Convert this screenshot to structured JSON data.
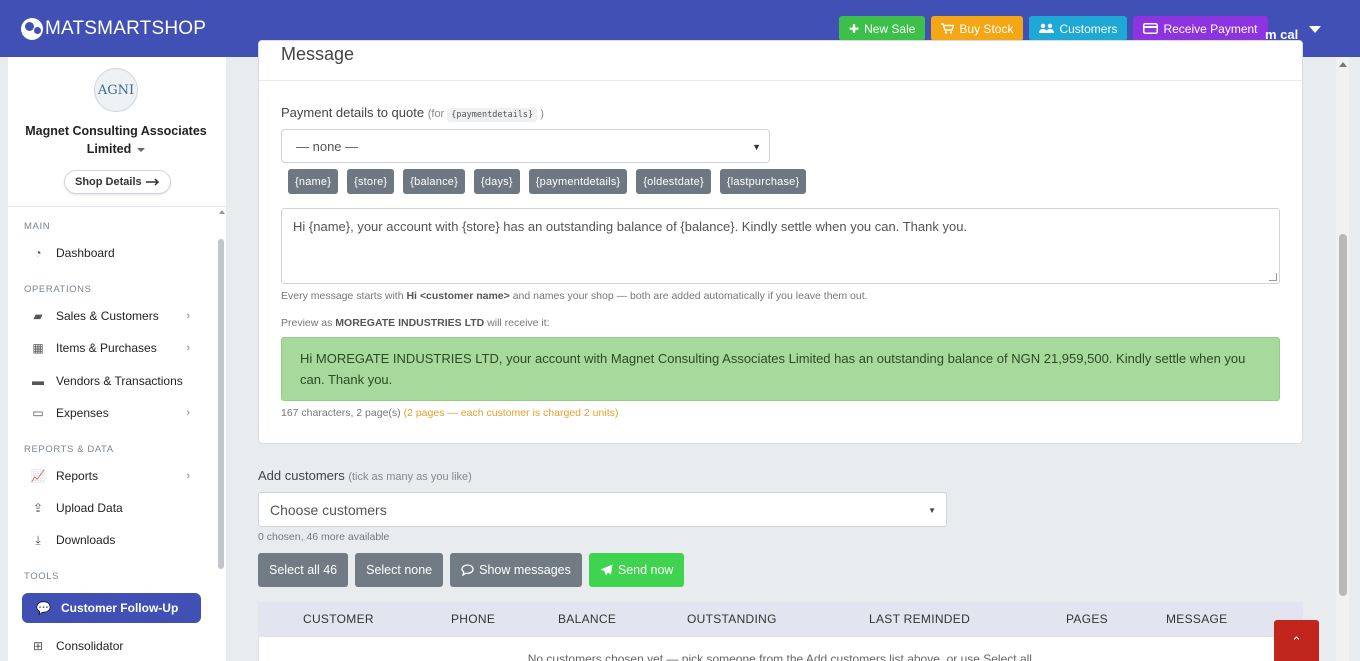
{
  "brand": {
    "name": "MATSMARTSHOP"
  },
  "topbar": {
    "new_sale": "New Sale",
    "buy_stock": "Buy Stock",
    "customers": "Customers",
    "receive_payment": "Receive Payment",
    "user": "m cal"
  },
  "sidebar": {
    "logo_text": "AGNI",
    "shop_name": "Magnet Consulting Associates Limited",
    "shop_details": "Shop Details",
    "sections": {
      "main": "MAIN",
      "operations": "OPERATIONS",
      "reports": "REPORTS & DATA",
      "tools": "TOOLS"
    },
    "items": {
      "dashboard": "Dashboard",
      "sales": "Sales & Customers",
      "items": "Items & Purchases",
      "vendors": "Vendors & Transactions",
      "expenses": "Expenses",
      "reports": "Reports",
      "upload": "Upload Data",
      "downloads": "Downloads",
      "followup": "Customer Follow-Up",
      "consolidator": "Consolidator"
    }
  },
  "message": {
    "title": "Message",
    "pay_label": "Payment details to quote",
    "pay_hint_prefix": "(for",
    "pay_hint_code": "{paymentdetails}",
    "pay_hint_suffix": ")",
    "pay_select": "— none —",
    "tags": [
      "{name}",
      "{store}",
      "{balance}",
      "{days}",
      "{paymentdetails}",
      "{oldestdate}",
      "{lastpurchase}"
    ],
    "body": "Hi {name}, your account with {store} has an outstanding balance of {balance}. Kindly settle when you can. Thank you.",
    "help_1": "Every message starts with",
    "help_bold": "Hi <customer name>",
    "help_2": "and names your shop — both are added automatically if you leave them out.",
    "preview_prefix": "Preview as",
    "preview_name": "MOREGATE INDUSTRIES LTD",
    "preview_suffix": "will receive it:",
    "preview_text": "Hi MOREGATE INDUSTRIES LTD, your account with Magnet Consulting Associates Limited has an outstanding balance of NGN 21,959,500. Kindly settle when you can. Thank you.",
    "counter": "167 characters, 2 page(s)",
    "counter_warn": "(2 pages — each customer is charged 2 units)"
  },
  "customers": {
    "label": "Add customers",
    "hint": "(tick as many as you like)",
    "placeholder": "Choose customers",
    "chosen": "0 chosen, 46 more available",
    "select_all": "Select all 46",
    "select_none": "Select none",
    "show_messages": "Show messages",
    "send_now": "Send now"
  },
  "table": {
    "columns": [
      "CUSTOMER",
      "PHONE",
      "BALANCE",
      "OUTSTANDING",
      "LAST REMINDED",
      "PAGES",
      "MESSAGE"
    ],
    "empty": "No customers chosen yet — pick someone from the Add customers list above, or use Select all."
  }
}
